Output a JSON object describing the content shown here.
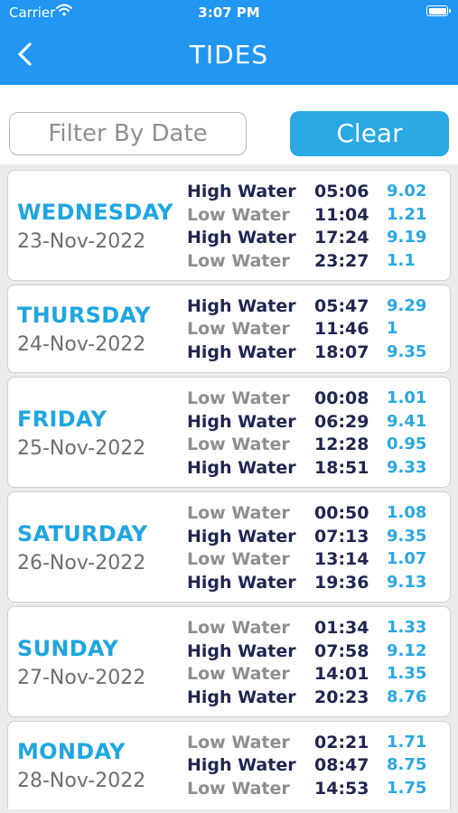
{
  "status_bar": {
    "carrier": "Carrier",
    "time": "3:07 PM"
  },
  "nav": {
    "title": "TIDES"
  },
  "filter": {
    "placeholder": "Filter By Date",
    "clear_label": "Clear"
  },
  "colors": {
    "primary": "#2196f3",
    "accent": "#29a8e2",
    "high_water": "#1f2550",
    "low_water": "#8e8e8e"
  },
  "days": [
    {
      "day": "WEDNESDAY",
      "date": "23-Nov-2022",
      "tides": [
        {
          "type": "High Water",
          "time": "05:06",
          "height": "9.02"
        },
        {
          "type": "Low Water",
          "time": "11:04",
          "height": "1.21"
        },
        {
          "type": "High Water",
          "time": "17:24",
          "height": "9.19"
        },
        {
          "type": "Low Water",
          "time": "23:27",
          "height": "1.1"
        }
      ]
    },
    {
      "day": "THURSDAY",
      "date": "24-Nov-2022",
      "tides": [
        {
          "type": "High Water",
          "time": "05:47",
          "height": "9.29"
        },
        {
          "type": "Low Water",
          "time": "11:46",
          "height": "1"
        },
        {
          "type": "High Water",
          "time": "18:07",
          "height": "9.35"
        }
      ]
    },
    {
      "day": "FRIDAY",
      "date": "25-Nov-2022",
      "tides": [
        {
          "type": "Low Water",
          "time": "00:08",
          "height": "1.01"
        },
        {
          "type": "High Water",
          "time": "06:29",
          "height": "9.41"
        },
        {
          "type": "Low Water",
          "time": "12:28",
          "height": "0.95"
        },
        {
          "type": "High Water",
          "time": "18:51",
          "height": "9.33"
        }
      ]
    },
    {
      "day": "SATURDAY",
      "date": "26-Nov-2022",
      "tides": [
        {
          "type": "Low Water",
          "time": "00:50",
          "height": "1.08"
        },
        {
          "type": "High Water",
          "time": "07:13",
          "height": "9.35"
        },
        {
          "type": "Low Water",
          "time": "13:14",
          "height": "1.07"
        },
        {
          "type": "High Water",
          "time": "19:36",
          "height": "9.13"
        }
      ]
    },
    {
      "day": "SUNDAY",
      "date": "27-Nov-2022",
      "tides": [
        {
          "type": "Low Water",
          "time": "01:34",
          "height": "1.33"
        },
        {
          "type": "High Water",
          "time": "07:58",
          "height": "9.12"
        },
        {
          "type": "Low Water",
          "time": "14:01",
          "height": "1.35"
        },
        {
          "type": "High Water",
          "time": "20:23",
          "height": "8.76"
        }
      ]
    },
    {
      "day": "MONDAY",
      "date": "28-Nov-2022",
      "tides": [
        {
          "type": "Low Water",
          "time": "02:21",
          "height": "1.71"
        },
        {
          "type": "High Water",
          "time": "08:47",
          "height": "8.75"
        },
        {
          "type": "Low Water",
          "time": "14:53",
          "height": "1.75"
        }
      ]
    }
  ]
}
